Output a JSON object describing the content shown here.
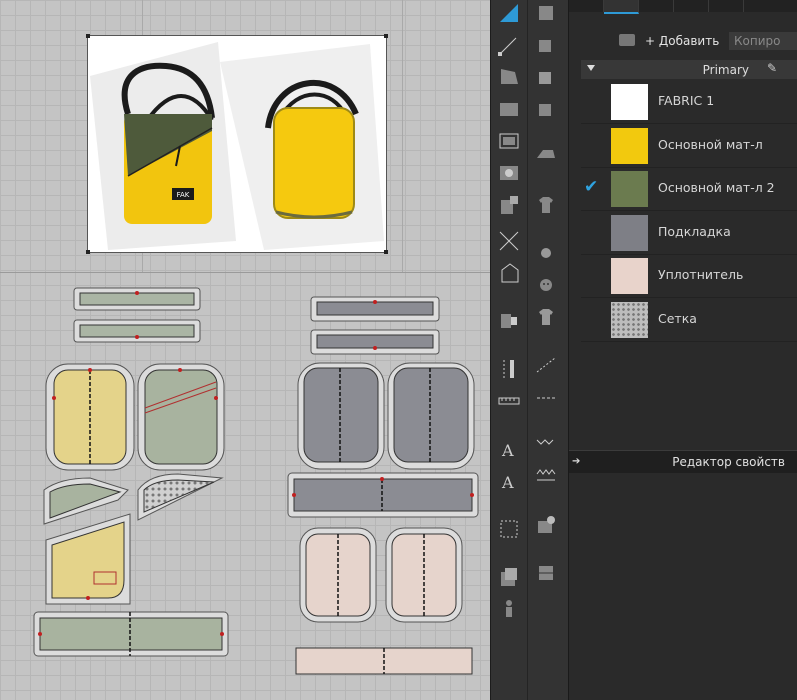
{
  "window": {
    "title": ""
  },
  "panel": {
    "tabs": [
      "fabric-list-tab",
      "object-browser-tab",
      "texture-tab",
      "avatar-tab",
      "tools-tab"
    ],
    "add_label": "+ Добавить",
    "copy_label": "Копиро",
    "group_name": "Primary",
    "fabrics": [
      {
        "name": "FABRIC 1",
        "color": "#ffffff",
        "selected": false
      },
      {
        "name": "Основной мат-л",
        "color": "#f2c90e",
        "selected": true
      },
      {
        "name": "Основной мат-л 2",
        "color": "#6b7b4f",
        "selected": true
      },
      {
        "name": "Подкладка",
        "color": "#7e7f86",
        "selected": false
      },
      {
        "name": "Уплотнитель",
        "color": "#e8d3cb",
        "selected": false
      },
      {
        "name": "Сетка",
        "color": "#b8b8b8",
        "selected": false
      }
    ],
    "property_editor_label": "Редактор свойств"
  },
  "reference_image": {
    "logo_text": "FAK"
  },
  "colors": {
    "accent": "#2e9ad6",
    "yellow_piece": "#e4d38a",
    "olive_piece": "#a8b39f",
    "gray_piece": "#8b8c93",
    "peach_piece": "#e6d4cc"
  }
}
